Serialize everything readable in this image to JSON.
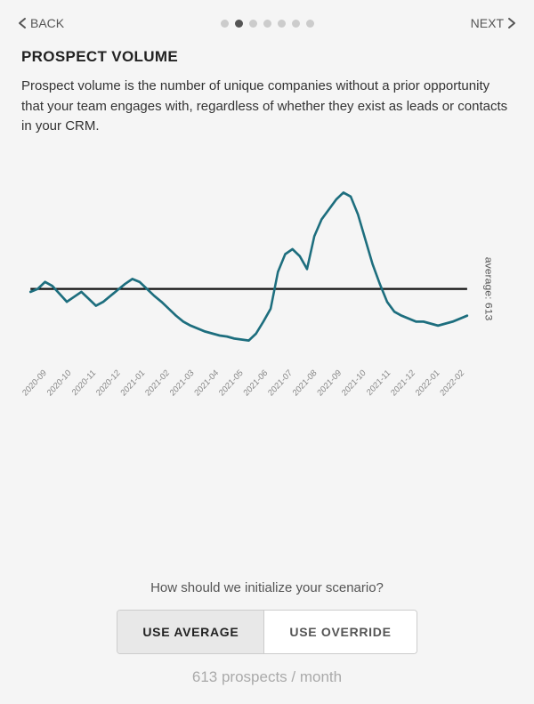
{
  "nav": {
    "back_label": "BACK",
    "next_label": "NEXT",
    "dots_count": 7,
    "active_dot": 1
  },
  "page": {
    "title": "PROSPECT VOLUME",
    "description": "Prospect volume is the number of unique companies without a prior opportunity that your team engages with, regardless of whether they exist as leads or contacts in your CRM."
  },
  "chart": {
    "average_label": "average: 613",
    "x_labels": [
      "2020-09",
      "2020-10",
      "2020-11",
      "2020-12",
      "2021-01",
      "2021-02",
      "2021-03",
      "2021-04",
      "2021-05",
      "2021-06",
      "2021-07",
      "2021-08",
      "2021-09",
      "2021-10",
      "2021-11",
      "2021-12",
      "2022-01",
      "2022-02"
    ]
  },
  "bottom": {
    "question": "How should we initialize your scenario?",
    "btn_average": "USE AVERAGE",
    "btn_override": "USE OVERRIDE",
    "result": "613 prospects / month"
  }
}
